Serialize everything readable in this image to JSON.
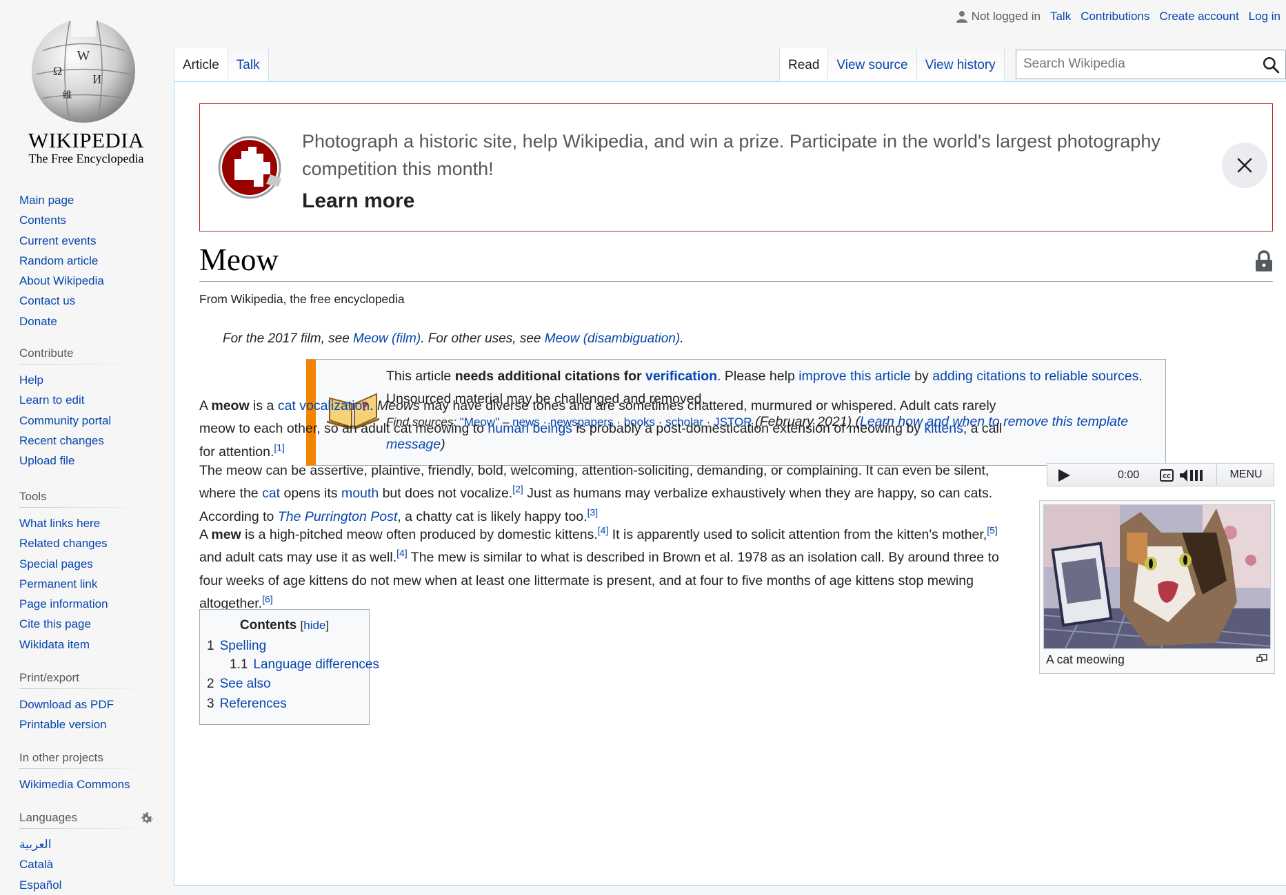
{
  "logo": {
    "wordmark": "WIKIPEDIA",
    "tagline": "The Free Encyclopedia"
  },
  "sidebar": {
    "main_items": [
      "Main page",
      "Contents",
      "Current events",
      "Random article",
      "About Wikipedia",
      "Contact us",
      "Donate"
    ],
    "contribute": {
      "heading": "Contribute",
      "items": [
        "Help",
        "Learn to edit",
        "Community portal",
        "Recent changes",
        "Upload file"
      ]
    },
    "tools": {
      "heading": "Tools",
      "items": [
        "What links here",
        "Related changes",
        "Special pages",
        "Permanent link",
        "Page information",
        "Cite this page",
        "Wikidata item"
      ]
    },
    "print": {
      "heading": "Print/export",
      "items": [
        "Download as PDF",
        "Printable version"
      ]
    },
    "projects": {
      "heading": "In other projects",
      "items": [
        "Wikimedia Commons"
      ]
    },
    "languages": {
      "heading": "Languages",
      "items": [
        "العربية",
        "Català",
        "Español"
      ]
    }
  },
  "personal": {
    "status": "Not logged in",
    "links": [
      "Talk",
      "Contributions",
      "Create account",
      "Log in"
    ]
  },
  "tabs": {
    "left": [
      "Article",
      "Talk"
    ],
    "right": [
      "Read",
      "View source",
      "View history"
    ]
  },
  "search": {
    "placeholder": "Search Wikipedia"
  },
  "banner": {
    "text": "Photograph a historic site, help Wikipedia, and win a prize. Participate in the world's largest photography competition this month!",
    "learn_more": "Learn more"
  },
  "article": {
    "title": "Meow",
    "tagline": "From Wikipedia, the free encyclopedia",
    "hatnote": {
      "pre": "For the 2017 film, see ",
      "link1": "Meow (film)",
      "mid": ". For other uses, see ",
      "link2": "Meow (disambiguation)",
      "post": "."
    },
    "ambox": {
      "t1": "This article ",
      "bold": "needs additional citations for ",
      "link_verification": "verification",
      "t2": ". Please help ",
      "link_improve": "improve this article",
      "t3": " by ",
      "link_adding": "adding citations to reliable sources",
      "t4": ". Unsourced material may be challenged and removed.",
      "find_label": "Find sources:",
      "find_query": "\"Meow\"",
      "dash": " – ",
      "sources": [
        "news",
        "newspapers",
        "books",
        "scholar",
        "JSTOR"
      ],
      "date": "(February 2021)",
      "learn_link": "Learn how and when to remove this template message",
      "open_paren": "(",
      "close_paren": ")"
    },
    "p1": {
      "a": "A ",
      "b": "meow",
      "c": " is a ",
      "link1": "cat vocalization",
      "d": ". ",
      "e": "Meows",
      "f": " may have diverse tones and are sometimes chattered, murmured or whispered. Adult cats rarely meow to each other, so an adult cat meowing to ",
      "link2": "human beings",
      "g": " is probably a post-domestication extension of meowing by ",
      "link3": "kittens",
      "h": "; a call for attention.",
      "ref1": "[1]"
    },
    "p2": {
      "a": "The meow can be assertive, plaintive, friendly, bold, welcoming, attention-soliciting, demanding, or complaining. It can even be silent, where the ",
      "link1": "cat",
      "b": " opens its ",
      "link2": "mouth",
      "c": " but does not vocalize.",
      "ref2": "[2]",
      "d": " Just as humans may verbalize exhaustively when they are happy, so can cats. According to ",
      "link3": "The Purrington Post",
      "e": ", a chatty cat is likely happy too.",
      "ref3": "[3]"
    },
    "p3": {
      "a": "A ",
      "b": "mew",
      "c": " is a high-pitched meow often produced by domestic kittens.",
      "ref4": "[4]",
      "d": " It is apparently used to solicit attention from the kitten's mother,",
      "ref5": "[5]",
      "e": " and adult cats may use it as well.",
      "ref4b": "[4]",
      "f": " The mew is similar to what is described in Brown et al. 1978 as an isolation call. By around three to four weeks of age kittens do not mew when at least one littermate is present, and at four to five months of age kittens stop mewing altogether.",
      "ref6": "[6]"
    }
  },
  "player": {
    "time": "0:00",
    "menu": "MENU"
  },
  "thumb": {
    "caption": "A cat meowing"
  },
  "toc": {
    "title": "Contents",
    "hide": "hide",
    "bracket_open": "[",
    "bracket_close": "]",
    "items": [
      {
        "num": "1",
        "label": "Spelling"
      },
      {
        "num": "1.1",
        "label": "Language differences"
      },
      {
        "num": "2",
        "label": "See also"
      },
      {
        "num": "3",
        "label": "References"
      }
    ]
  },
  "colors": {
    "link": "#0645ad",
    "banner_border": "#b32424",
    "ambox_stripe": "#f28500"
  }
}
